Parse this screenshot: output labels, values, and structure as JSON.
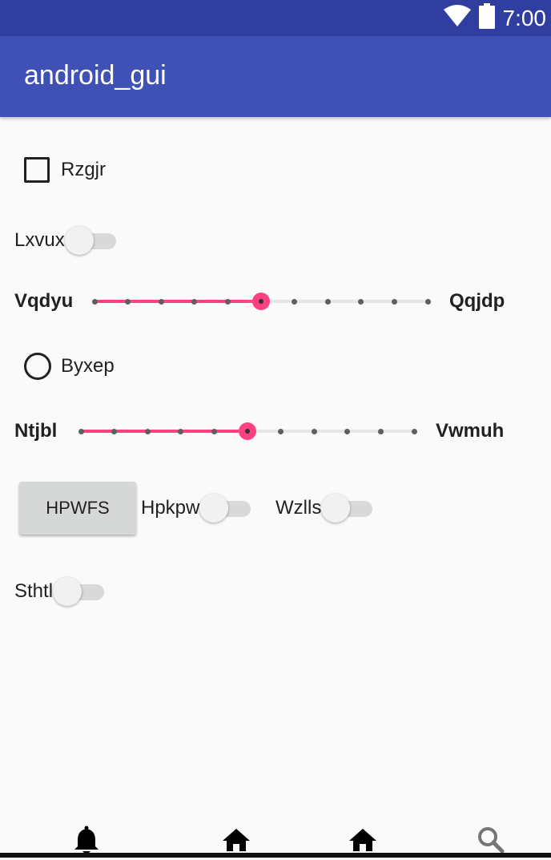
{
  "status_bar": {
    "time": "7:00",
    "icons": [
      "wifi-icon",
      "battery-icon"
    ]
  },
  "app_bar": {
    "title": "android_gui"
  },
  "checkbox": {
    "label": "Rzgjr",
    "checked": false
  },
  "switch_1": {
    "label": "Lxvux",
    "on": false
  },
  "seekbar_1": {
    "start_label": "Vqdyu",
    "end_label": "Qqjdp",
    "value": 5,
    "max": 10
  },
  "radio": {
    "label": "Byxep",
    "selected": false
  },
  "seekbar_2": {
    "start_label": "Ntjbl",
    "end_label": "Vwmuh",
    "value": 5,
    "max": 10
  },
  "button": {
    "label": "HPWFS"
  },
  "switch_2": {
    "label": "Hpkpw",
    "on": false
  },
  "switch_3": {
    "label": "Wzlls",
    "on": false
  },
  "switch_4": {
    "label": "Sthtl",
    "on": false
  },
  "bottom_nav": {
    "items": [
      "bell-icon",
      "home-icon",
      "home-icon",
      "search-icon"
    ]
  },
  "colors": {
    "status_bar": "#303f9f",
    "app_bar": "#3f51b5",
    "accent": "#ff4081",
    "background": "#fafafa"
  }
}
